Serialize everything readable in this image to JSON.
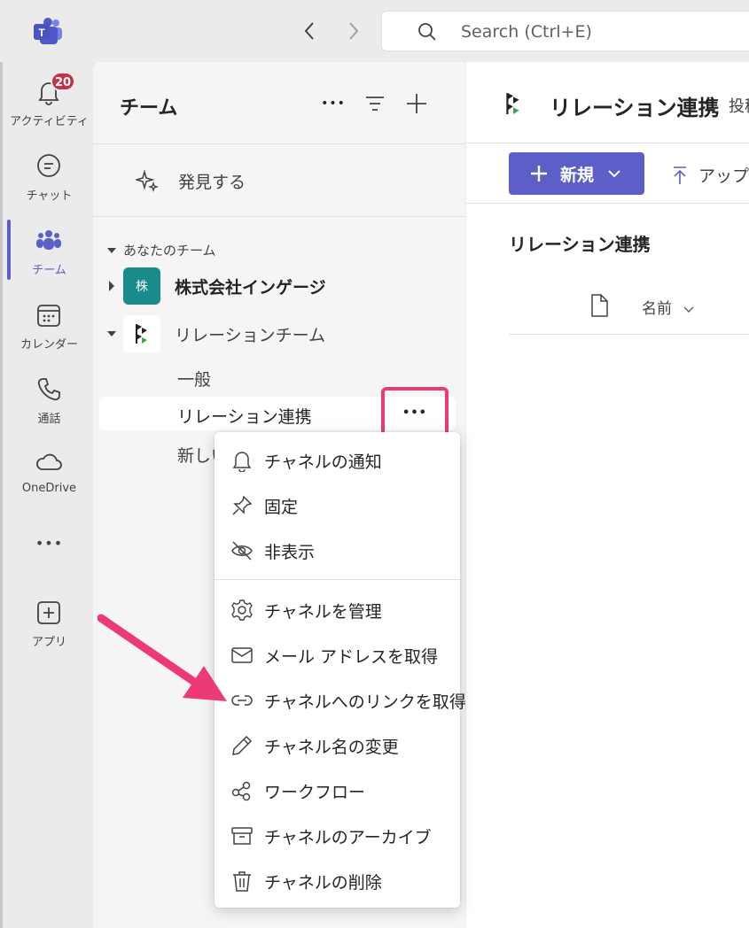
{
  "topbar": {
    "search_placeholder": "Search (Ctrl+E)"
  },
  "rail": {
    "activity": {
      "label": "アクティビティ",
      "badge": "20"
    },
    "chat": {
      "label": "チャット"
    },
    "teams": {
      "label": "チーム"
    },
    "calendar": {
      "label": "カレンダー"
    },
    "calls": {
      "label": "通話"
    },
    "onedrive": {
      "label": "OneDrive"
    },
    "more": {
      "label": "•••"
    },
    "apps": {
      "label": "アプリ"
    }
  },
  "panel": {
    "title": "チーム",
    "more": "•••",
    "discover": "発見する",
    "section": "あなたのチーム",
    "teams": [
      {
        "name": "株式会社インゲージ",
        "avatar_text": "株",
        "avatar_color": "#1b8a8a"
      },
      {
        "name": "リレーションチーム"
      }
    ],
    "channels": [
      "一般",
      "リレーション連携",
      "新しい"
    ],
    "more_dots": "•••"
  },
  "main": {
    "channel_title": "リレーション連携",
    "tab_partial": "投稿",
    "new_button": "新規",
    "upload": "アップ",
    "library_title": "リレーション連携",
    "column_name": "名前"
  },
  "menu": {
    "items": [
      {
        "label": "チャネルの通知",
        "icon": "bell-icon"
      },
      {
        "label": "固定",
        "icon": "pin-icon"
      },
      {
        "label": "非表示",
        "icon": "eye-off-icon"
      },
      {
        "label": "チャネルを管理",
        "icon": "gear-icon"
      },
      {
        "label": "メール アドレスを取得",
        "icon": "mail-icon"
      },
      {
        "label": "チャネルへのリンクを取得",
        "icon": "link-icon"
      },
      {
        "label": "チャネル名の変更",
        "icon": "pencil-icon"
      },
      {
        "label": "ワークフロー",
        "icon": "workflow-icon"
      },
      {
        "label": "チャネルのアーカイブ",
        "icon": "archive-icon"
      },
      {
        "label": "チャネルの削除",
        "icon": "trash-icon"
      }
    ]
  },
  "colors": {
    "accent": "#5b5fc7",
    "highlight": "#ec3a77",
    "badge": "#c4314b"
  }
}
